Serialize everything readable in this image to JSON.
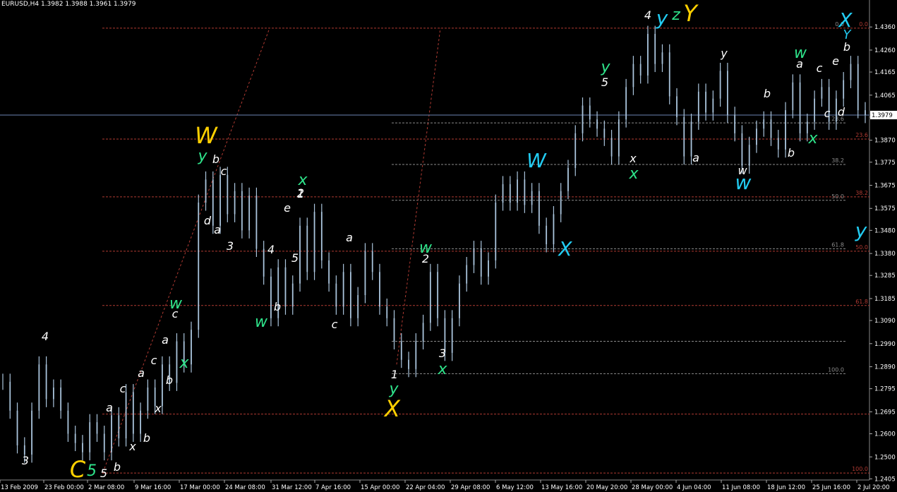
{
  "window_title": "EURUSD,H4  1.3982 1.3988 1.3961 1.3979",
  "colors": {
    "background": "#000000",
    "candle": "#aac4dc",
    "level_red": "#b03a32",
    "level_grey": "#8a8a8a",
    "line_blue": "#6c85b4",
    "white": "#ffffff",
    "green": "#2ee38a",
    "cyan": "#22ccf2",
    "yellow": "#ffd000"
  },
  "chart_data": {
    "type": "line",
    "title": "EURUSD,H4",
    "ohlc_header": "1.3982 1.3988 1.3961 1.3979",
    "y_ticks": [
      "1.4360",
      "1.4260",
      "1.4165",
      "1.4065",
      "1.3970",
      "1.3870",
      "1.3775",
      "1.3675",
      "1.3575",
      "1.3480",
      "1.3380",
      "1.3285",
      "1.3185",
      "1.3090",
      "1.2990",
      "1.2890",
      "1.2795",
      "1.2695",
      "1.2600",
      "1.2500",
      "1.2405"
    ],
    "x_ticks": [
      "13 Feb 2009",
      "23 Feb 00:00",
      "2 Mar 08:00",
      "9 Mar 16:00",
      "17 Mar 00:00",
      "24 Mar 08:00",
      "31 Mar 12:00",
      "7 Apr 16:00",
      "15 Apr 00:00",
      "22 Apr 04:00",
      "29 Apr 08:00",
      "6 May 12:00",
      "13 May 16:00",
      "20 May 20:00",
      "28 May 00:00",
      "4 Jun 04:00",
      "11 Jun 08:00",
      "18 Jun 12:00",
      "25 Jun 16:00",
      "2 Jul 20:00"
    ],
    "ylim": [
      1.24,
      1.444
    ],
    "current_price": "1.3979",
    "series": [
      {
        "values": [
          1.2825,
          1.27,
          1.255,
          1.251,
          1.27,
          1.29,
          1.275,
          1.28,
          1.27,
          1.26,
          1.256,
          1.252,
          1.265,
          1.26,
          1.252,
          1.268,
          1.258,
          1.278,
          1.26,
          1.27,
          1.28,
          1.272,
          1.29,
          1.282,
          1.3,
          1.29,
          1.305,
          1.36,
          1.37,
          1.35,
          1.372,
          1.355,
          1.365,
          1.348,
          1.363,
          1.34,
          1.328,
          1.31,
          1.332,
          1.315,
          1.325,
          1.35,
          1.33,
          1.356,
          1.335,
          1.325,
          1.315,
          1.33,
          1.31,
          1.32,
          1.339,
          1.33,
          1.315,
          1.31,
          1.3,
          1.292,
          1.288,
          1.3,
          1.308,
          1.33,
          1.31,
          1.295,
          1.31,
          1.325,
          1.333,
          1.34,
          1.328,
          1.335,
          1.36,
          1.368,
          1.36,
          1.37,
          1.359,
          1.365,
          1.35,
          1.342,
          1.355,
          1.365,
          1.375,
          1.39,
          1.402,
          1.396,
          1.392,
          1.388,
          1.38,
          1.396,
          1.41,
          1.42,
          1.415,
          1.433,
          1.42,
          1.425,
          1.406,
          1.397,
          1.38,
          1.395,
          1.408,
          1.399,
          1.405,
          1.417,
          1.398,
          1.39,
          1.376,
          1.385,
          1.392,
          1.396,
          1.388,
          1.383,
          1.4,
          1.412,
          1.39,
          1.395,
          1.405,
          1.41,
          1.395,
          1.405,
          1.413,
          1.42,
          1.4,
          1.3979
        ]
      }
    ]
  },
  "fib_labels": {
    "right": [
      "0.0",
      "23.6",
      "38.2",
      "50.0",
      "61.8",
      "100.0"
    ],
    "left": [
      "0.0",
      "23.6",
      "38.2",
      "50.0",
      "61.8",
      "100.0"
    ]
  },
  "wave_labels": {
    "white": [
      "4",
      "3",
      "a",
      "c",
      "5",
      "b",
      "x",
      "b",
      "a",
      "c",
      "x",
      "a",
      "b",
      "c",
      "b",
      "d",
      "a",
      "c",
      "e",
      "1",
      "3",
      "4",
      "5",
      "2",
      "b",
      "a",
      "c",
      "1",
      "2",
      "3",
      "5",
      "4",
      "x",
      "y",
      "w",
      "a",
      "b",
      "c",
      "a",
      "c",
      "e",
      "b",
      "d",
      "b"
    ],
    "green": [
      "5",
      "w",
      "x",
      "y",
      "w",
      "x",
      "x",
      "w",
      "y",
      "x",
      "y",
      "z",
      "w",
      "x"
    ],
    "cyan": [
      "y",
      "W",
      "X",
      "w",
      "y",
      "X",
      "Y"
    ],
    "yellow": [
      "C",
      "W",
      "X",
      "Y"
    ]
  }
}
